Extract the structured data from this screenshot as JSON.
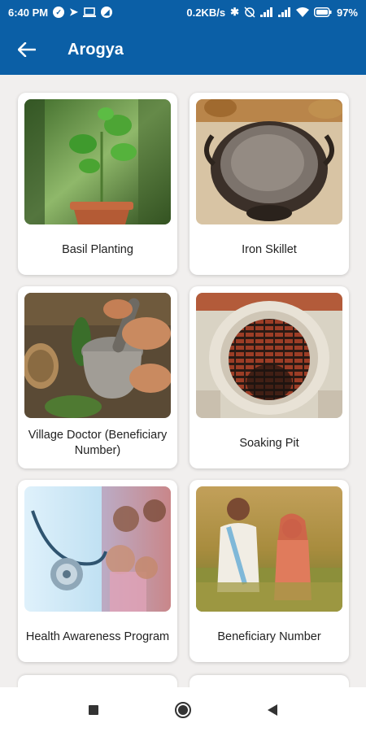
{
  "status_bar": {
    "time": "6:40 PM",
    "net_speed": "0.2KB/s",
    "battery": "97%"
  },
  "app_bar": {
    "title": "Arogya",
    "back_icon": "arrow-left-icon"
  },
  "cards": [
    {
      "label": "Basil Planting",
      "image": "basil-plant-image"
    },
    {
      "label": "Iron Skillet",
      "image": "iron-skillet-image"
    },
    {
      "label": "Village Doctor (Beneficiary Number)",
      "image": "mortar-pestle-image"
    },
    {
      "label": "Soaking Pit",
      "image": "soaking-pit-image"
    },
    {
      "label": "Health Awareness Program",
      "image": "stethoscope-family-image"
    },
    {
      "label": "Beneficiary Number",
      "image": "couple-field-image"
    }
  ],
  "nav_bar": {
    "recents_icon": "square-icon",
    "home_icon": "circle-icon",
    "back_icon": "triangle-back-icon"
  },
  "colors": {
    "primary": "#0b5fa6",
    "background": "#f1efee",
    "card": "#ffffff"
  }
}
